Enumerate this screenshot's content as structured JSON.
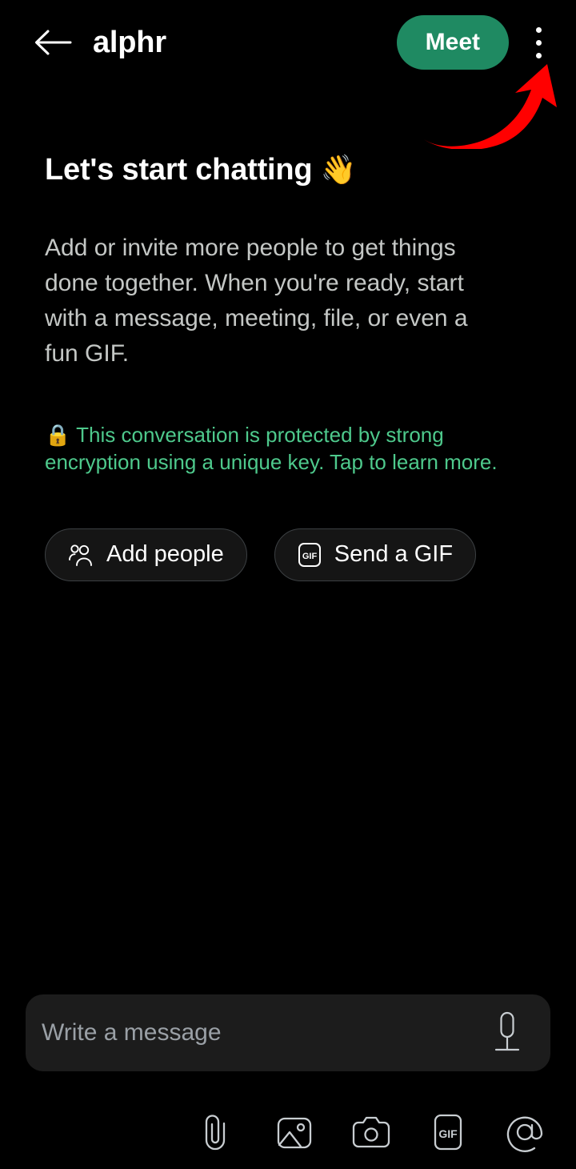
{
  "appbar": {
    "back_icon": "arrow-left-icon",
    "title": "alphr",
    "meet_label": "Meet",
    "overflow_icon": "more-vertical-icon"
  },
  "annotation": {
    "type": "curved-arrow",
    "color": "#FF0000",
    "points_to": "overflow-menu-button"
  },
  "main": {
    "headline": "Let's start chatting",
    "headline_emoji": "👋",
    "blurb": "Add or invite more people to get things done together. When you're ready, start with a message, meeting, file, or even a fun GIF.",
    "encryption_emoji": "🔒",
    "encryption_note": "This conversation is protected by strong encryption using a unique key. Tap to learn more.",
    "actions": [
      {
        "label": "Add people",
        "icon": "people-group-icon"
      },
      {
        "label": "Send a GIF",
        "icon": "gif-box-icon"
      }
    ]
  },
  "composer": {
    "placeholder": "Write a message",
    "value": "",
    "mic_icon": "microphone-icon"
  },
  "toolbar": {
    "items": [
      {
        "icon": "paperclip-icon",
        "name": "attach-file-button"
      },
      {
        "icon": "image-icon",
        "name": "gallery-button"
      },
      {
        "icon": "camera-icon",
        "name": "camera-button"
      },
      {
        "icon": "gif-icon",
        "name": "gif-button",
        "text": "GIF"
      },
      {
        "icon": "at-mention-icon",
        "name": "mention-button"
      }
    ]
  },
  "colors": {
    "background": "#000000",
    "accent_green": "#1F8A62",
    "encryption_green": "#4EC98C",
    "annotation_red": "#FF0000",
    "composer_bg": "#1C1C1C",
    "body_text": "#C4C7C5",
    "icon_stroke": "#C8CDD1"
  }
}
